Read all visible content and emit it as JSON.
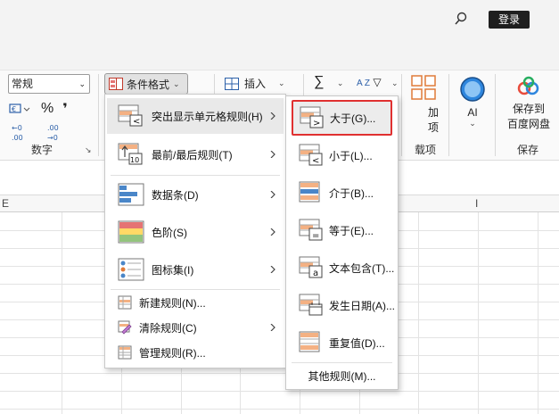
{
  "titlebar": {
    "login_label": "登录"
  },
  "ribbon": {
    "number_format_value": "常规",
    "percent_symbol": "%",
    "comma_symbol": "❜",
    "number_group_label": "数字",
    "conditional_format_label": "条件格式",
    "insert_label": "插入",
    "sum_symbol": "∑",
    "sort_label": "A Z",
    "add_partial": "加",
    "options_partial": "项",
    "addins_partial": "载项",
    "ai_label": "AI",
    "save_to_label_line1": "保存到",
    "save_to_label_line2": "百度网盘",
    "save_group_label": "保存"
  },
  "sheet": {
    "col_e": "E",
    "col_i": "I"
  },
  "menu1": {
    "items": [
      {
        "label": "突出显示单元格规则(H)",
        "letter": "H"
      },
      {
        "label": "最前/最后规则(T)",
        "letter": "T"
      },
      {
        "label": "数据条(D)",
        "letter": "D"
      },
      {
        "label": "色阶(S)",
        "letter": "S"
      },
      {
        "label": "图标集(I)",
        "letter": "I"
      }
    ],
    "small_items": [
      {
        "label": "新建规则(N)..."
      },
      {
        "label": "清除规则(C)"
      },
      {
        "label": "管理规则(R)..."
      }
    ]
  },
  "menu2": {
    "items": [
      {
        "label": "大于(G)...",
        "symbol": ">"
      },
      {
        "label": "小于(L)...",
        "symbol": "<"
      },
      {
        "label": "介于(B)..."
      },
      {
        "label": "等于(E)...",
        "symbol": "="
      },
      {
        "label": "文本包含(T)...",
        "symbol": "a"
      },
      {
        "label": "发生日期(A)..."
      },
      {
        "label": "重复值(D)..."
      }
    ],
    "other_label": "其他规则(M)..."
  },
  "colors": {
    "accent_red": "#e03030",
    "highlight": "#e9e9e9",
    "orange_fill": "#f4b183",
    "blue_fill": "#4a86c8"
  }
}
